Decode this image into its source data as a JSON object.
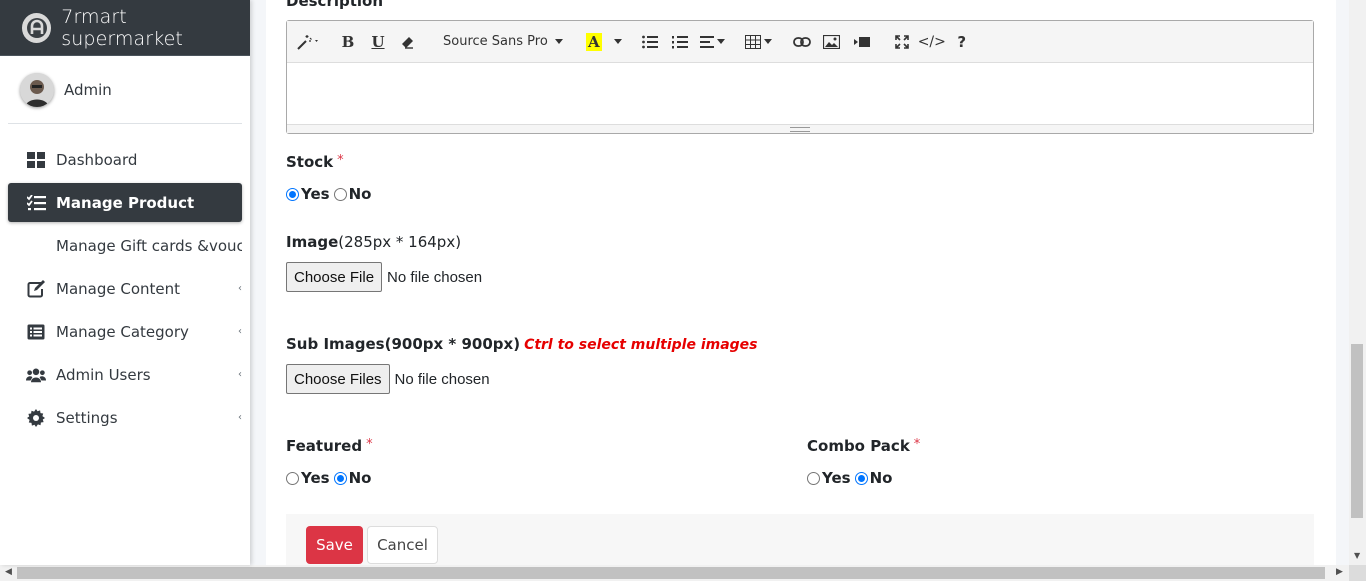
{
  "brand": {
    "title": "7rmart supermarket"
  },
  "user": {
    "name": "Admin"
  },
  "sidebar": {
    "items": [
      {
        "label": "Dashboard"
      },
      {
        "label": "Manage Product"
      },
      {
        "label": "Manage Gift cards &voucher"
      },
      {
        "label": "Manage Content"
      },
      {
        "label": "Manage Category"
      },
      {
        "label": "Admin Users"
      },
      {
        "label": "Settings"
      }
    ]
  },
  "form": {
    "description_label": "Description",
    "editor": {
      "font_name": "Source Sans Pro"
    },
    "stock": {
      "label": "Stock",
      "required": "*",
      "yes": "Yes",
      "no": "No",
      "selected": "Yes"
    },
    "image": {
      "label": "Image",
      "hint": "(285px * 164px)",
      "button": "Choose File",
      "status": "No file chosen"
    },
    "sub_images": {
      "label": "Sub Images(900px * 900px)",
      "note": "Ctrl to select multiple images",
      "button": "Choose Files",
      "status": "No file chosen"
    },
    "featured": {
      "label": "Featured",
      "required": "*",
      "yes": "Yes",
      "no": "No",
      "selected": "No"
    },
    "combo_pack": {
      "label": "Combo Pack",
      "required": "*",
      "yes": "Yes",
      "no": "No",
      "selected": "No"
    },
    "save_label": "Save",
    "cancel_label": "Cancel"
  },
  "colors": {
    "sidebar_dark": "#343a40",
    "save_red": "#dc3545",
    "radio_blue": "#0075ff",
    "note_red": "#e60000"
  }
}
